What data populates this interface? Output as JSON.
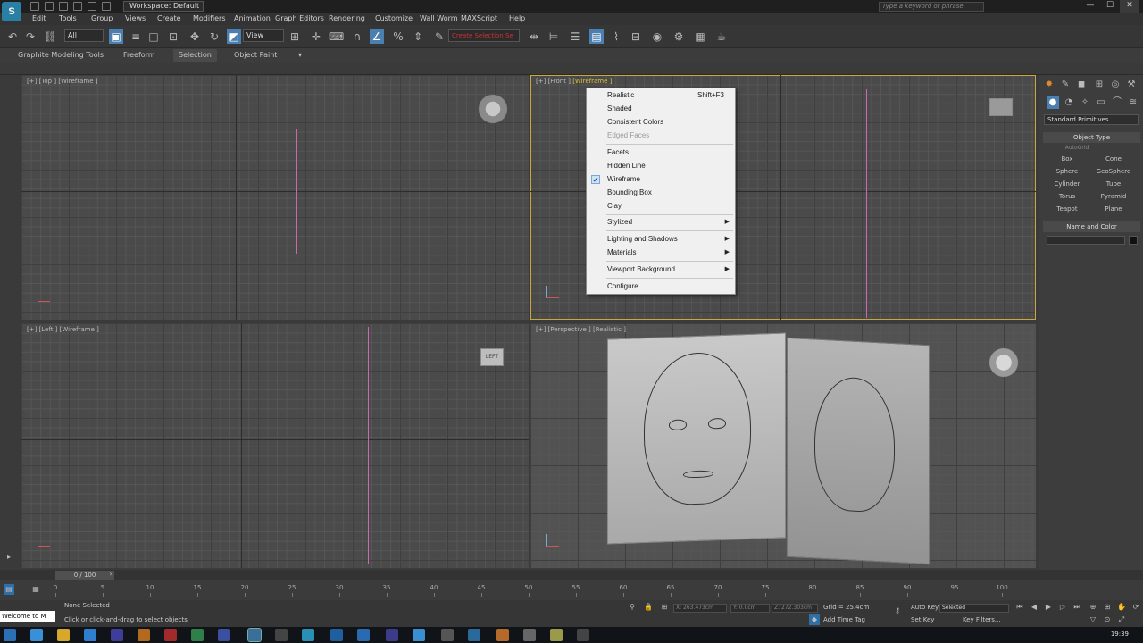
{
  "titlebar": {
    "app_logo": "S",
    "workspace": "Workspace: Default",
    "search_placeholder": "Type a keyword or phrase",
    "min": "—",
    "max": "☐",
    "close": "✕"
  },
  "menubar": {
    "items": [
      "Edit",
      "Tools",
      "Group",
      "Views",
      "Create",
      "Modifiers",
      "Animation",
      "Graph Editors",
      "Rendering",
      "Customize",
      "Wall Worm",
      "MAXScript",
      "Help"
    ]
  },
  "toolbar": {
    "filter_value": "All",
    "view_value": "View",
    "selection_set": "Create Selection Se"
  },
  "ribbon": {
    "tabs": [
      "Graphite Modeling Tools",
      "Freeform",
      "Selection",
      "Object Paint"
    ],
    "active_tab": "Selection"
  },
  "viewports": {
    "top": {
      "label_prefix": "[+] [Top ]",
      "label_mode": "[Wireframe ]"
    },
    "front": {
      "label_prefix": "[+] [Front ]",
      "label_mode": "[Wireframe ]"
    },
    "left": {
      "label_prefix": "[+] [Left ]",
      "label_mode": "[Wireframe ]"
    },
    "perspective": {
      "label_prefix": "[+] [Perspective ]",
      "label_mode": "[Realistic ]"
    },
    "left_cube_text": "LEFT"
  },
  "context_menu": {
    "items": [
      {
        "label": "Realistic",
        "shortcut": "Shift+F3"
      },
      {
        "label": "Shaded"
      },
      {
        "label": "Consistent Colors"
      },
      {
        "label": "Edged Faces",
        "disabled": true
      },
      {
        "label": "Facets"
      },
      {
        "label": "Hidden Line"
      },
      {
        "label": "Wireframe",
        "checked": true
      },
      {
        "label": "Bounding Box"
      },
      {
        "label": "Clay"
      },
      {
        "label": "Stylized",
        "submenu": true
      },
      {
        "label": "Lighting and Shadows",
        "submenu": true
      },
      {
        "label": "Materials",
        "submenu": true
      },
      {
        "label": "Viewport Background",
        "submenu": true
      },
      {
        "label": "Configure..."
      }
    ]
  },
  "command_panel": {
    "dropdown": "Standard Primitives",
    "object_type_header": "Object Type",
    "autogrid": "AutoGrid",
    "buttons": [
      "Box",
      "Cone",
      "Sphere",
      "GeoSphere",
      "Cylinder",
      "Tube",
      "Torus",
      "Pyramid",
      "Teapot",
      "Plane"
    ],
    "name_color_header": "Name and Color"
  },
  "timeline": {
    "slider": "0 / 100",
    "ticks": [
      "0",
      "5",
      "10",
      "15",
      "20",
      "25",
      "30",
      "35",
      "40",
      "45",
      "50",
      "55",
      "60",
      "65",
      "70",
      "75",
      "80",
      "85",
      "90",
      "95",
      "100"
    ]
  },
  "status": {
    "selection": "None Selected",
    "prompt": "Click or click-and-drag to select objects",
    "maxscript": "Welcome to M",
    "x_field": "X: 263.473cm",
    "y_field": "Y: 0.0cm",
    "z_field": "Z: 272.303cm",
    "grid": "Grid = 25.4cm",
    "auto_key": "Auto Key",
    "selected_dropdown": "Selected",
    "set_key": "Set Key",
    "key_filters": "Key Filters...",
    "add_time_tag": "Add Time Tag"
  },
  "taskbar": {
    "clock": "19:39"
  },
  "colors": {
    "active_viewport": "#c9a83e",
    "pink_line": "#c86ab0",
    "menu_bg": "#f0f0f0"
  }
}
